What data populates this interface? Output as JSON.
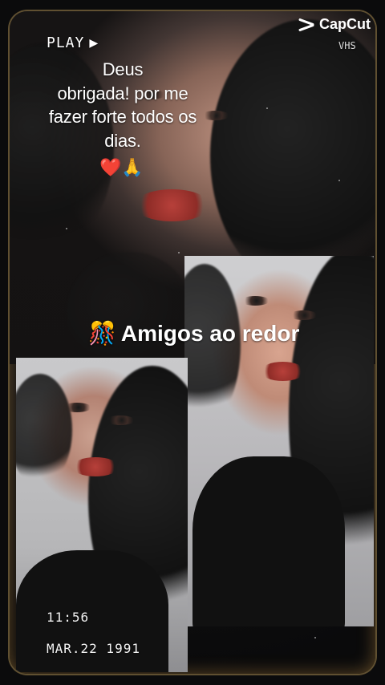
{
  "header": {
    "play_label": "PLAY",
    "vhs_label": "VHS",
    "brand": "CapCut"
  },
  "overlay": {
    "quote_lines": [
      "Deus",
      "obrigada! por me",
      "fazer forte todos os dias."
    ],
    "emoji": "❤️🙏",
    "caption_prefix_emoji": "🎊",
    "caption": "Amigos ao redor"
  },
  "timestamp": {
    "time": "11:56",
    "date": "MAR.22 1991"
  },
  "icons": {
    "play": "play-icon",
    "capcut_logo": "capcut-logo-icon"
  },
  "colors": {
    "frame_glow": "#ffd278",
    "text": "#ffffff",
    "background": "#0b0b0c",
    "lips": "#b7403a"
  }
}
